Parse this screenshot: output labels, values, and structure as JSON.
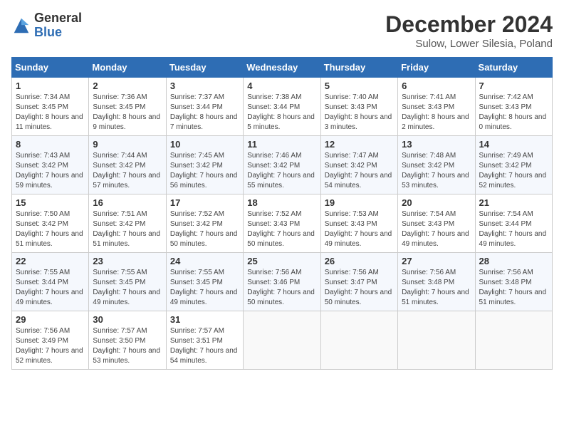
{
  "header": {
    "logo_general": "General",
    "logo_blue": "Blue",
    "month_title": "December 2024",
    "subtitle": "Sulow, Lower Silesia, Poland"
  },
  "weekdays": [
    "Sunday",
    "Monday",
    "Tuesday",
    "Wednesday",
    "Thursday",
    "Friday",
    "Saturday"
  ],
  "weeks": [
    [
      {
        "day": "1",
        "sunrise": "7:34 AM",
        "sunset": "3:45 PM",
        "daylight": "8 hours and 11 minutes."
      },
      {
        "day": "2",
        "sunrise": "7:36 AM",
        "sunset": "3:45 PM",
        "daylight": "8 hours and 9 minutes."
      },
      {
        "day": "3",
        "sunrise": "7:37 AM",
        "sunset": "3:44 PM",
        "daylight": "8 hours and 7 minutes."
      },
      {
        "day": "4",
        "sunrise": "7:38 AM",
        "sunset": "3:44 PM",
        "daylight": "8 hours and 5 minutes."
      },
      {
        "day": "5",
        "sunrise": "7:40 AM",
        "sunset": "3:43 PM",
        "daylight": "8 hours and 3 minutes."
      },
      {
        "day": "6",
        "sunrise": "7:41 AM",
        "sunset": "3:43 PM",
        "daylight": "8 hours and 2 minutes."
      },
      {
        "day": "7",
        "sunrise": "7:42 AM",
        "sunset": "3:43 PM",
        "daylight": "8 hours and 0 minutes."
      }
    ],
    [
      {
        "day": "8",
        "sunrise": "7:43 AM",
        "sunset": "3:42 PM",
        "daylight": "7 hours and 59 minutes."
      },
      {
        "day": "9",
        "sunrise": "7:44 AM",
        "sunset": "3:42 PM",
        "daylight": "7 hours and 57 minutes."
      },
      {
        "day": "10",
        "sunrise": "7:45 AM",
        "sunset": "3:42 PM",
        "daylight": "7 hours and 56 minutes."
      },
      {
        "day": "11",
        "sunrise": "7:46 AM",
        "sunset": "3:42 PM",
        "daylight": "7 hours and 55 minutes."
      },
      {
        "day": "12",
        "sunrise": "7:47 AM",
        "sunset": "3:42 PM",
        "daylight": "7 hours and 54 minutes."
      },
      {
        "day": "13",
        "sunrise": "7:48 AM",
        "sunset": "3:42 PM",
        "daylight": "7 hours and 53 minutes."
      },
      {
        "day": "14",
        "sunrise": "7:49 AM",
        "sunset": "3:42 PM",
        "daylight": "7 hours and 52 minutes."
      }
    ],
    [
      {
        "day": "15",
        "sunrise": "7:50 AM",
        "sunset": "3:42 PM",
        "daylight": "7 hours and 51 minutes."
      },
      {
        "day": "16",
        "sunrise": "7:51 AM",
        "sunset": "3:42 PM",
        "daylight": "7 hours and 51 minutes."
      },
      {
        "day": "17",
        "sunrise": "7:52 AM",
        "sunset": "3:42 PM",
        "daylight": "7 hours and 50 minutes."
      },
      {
        "day": "18",
        "sunrise": "7:52 AM",
        "sunset": "3:43 PM",
        "daylight": "7 hours and 50 minutes."
      },
      {
        "day": "19",
        "sunrise": "7:53 AM",
        "sunset": "3:43 PM",
        "daylight": "7 hours and 49 minutes."
      },
      {
        "day": "20",
        "sunrise": "7:54 AM",
        "sunset": "3:43 PM",
        "daylight": "7 hours and 49 minutes."
      },
      {
        "day": "21",
        "sunrise": "7:54 AM",
        "sunset": "3:44 PM",
        "daylight": "7 hours and 49 minutes."
      }
    ],
    [
      {
        "day": "22",
        "sunrise": "7:55 AM",
        "sunset": "3:44 PM",
        "daylight": "7 hours and 49 minutes."
      },
      {
        "day": "23",
        "sunrise": "7:55 AM",
        "sunset": "3:45 PM",
        "daylight": "7 hours and 49 minutes."
      },
      {
        "day": "24",
        "sunrise": "7:55 AM",
        "sunset": "3:45 PM",
        "daylight": "7 hours and 49 minutes."
      },
      {
        "day": "25",
        "sunrise": "7:56 AM",
        "sunset": "3:46 PM",
        "daylight": "7 hours and 50 minutes."
      },
      {
        "day": "26",
        "sunrise": "7:56 AM",
        "sunset": "3:47 PM",
        "daylight": "7 hours and 50 minutes."
      },
      {
        "day": "27",
        "sunrise": "7:56 AM",
        "sunset": "3:48 PM",
        "daylight": "7 hours and 51 minutes."
      },
      {
        "day": "28",
        "sunrise": "7:56 AM",
        "sunset": "3:48 PM",
        "daylight": "7 hours and 51 minutes."
      }
    ],
    [
      {
        "day": "29",
        "sunrise": "7:56 AM",
        "sunset": "3:49 PM",
        "daylight": "7 hours and 52 minutes."
      },
      {
        "day": "30",
        "sunrise": "7:57 AM",
        "sunset": "3:50 PM",
        "daylight": "7 hours and 53 minutes."
      },
      {
        "day": "31",
        "sunrise": "7:57 AM",
        "sunset": "3:51 PM",
        "daylight": "7 hours and 54 minutes."
      },
      null,
      null,
      null,
      null
    ]
  ]
}
